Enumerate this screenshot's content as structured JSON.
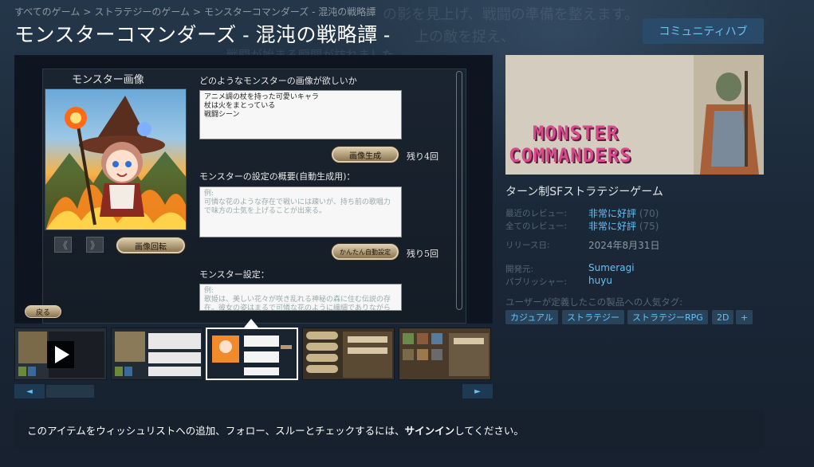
{
  "breadcrumb": [
    "すべてのゲーム",
    "ストラテジーのゲーム",
    "モンスターコマンダーズ - 混沌の戦略譚"
  ],
  "title": "モンスターコマンダーズ - 混沌の戦略譚 -",
  "community_hub": "コミュニティハブ",
  "background_text": [
    "の影を見上げ、戦闘の準備を整えます。",
    "上の敵を捉え、",
    "戦闘が始まる瞬間が訪れました"
  ],
  "game_ui": {
    "portrait_heading": "モンスター画像",
    "q1_label": "どのようなモンスターの画像が欲しいか",
    "q1_text": [
      "アニメ調の杖を持った可愛いキャラ",
      "杖は火をまとっている",
      "戦闘シーン"
    ],
    "generate_button": "画像生成",
    "generate_remaining": "残り4回",
    "q2_label": "モンスターの設定の概要(自動生成用)：",
    "q2_placeholder": [
      "例:",
      "可憐な花のような存在で戦いには疎いが、持ち前の歌唱力",
      "で味方の士気を上げることが出来る。"
    ],
    "auto_button": "かんたん自動設定",
    "auto_remaining": "残り5回",
    "rotate_button": "画像回転",
    "prev_arrow": "《",
    "next_arrow": "》",
    "q3_label": "モンスター設定：",
    "q3_placeholder": [
      "例:",
      "歌姫は、美しい花々が咲き乱れる神秘の森に住む伝説の存",
      "在。彼女の姿はまるで可憐な花のように繊細でありながら"
    ],
    "back_button": "戻る"
  },
  "slider": {
    "left": "◄",
    "right": "►"
  },
  "capsule_logo": [
    "MONSTER",
    "COMMANDERS"
  ],
  "short_desc": "ターン制SFストラテジーゲーム",
  "reviews": {
    "recent_label": "最近のレビュー:",
    "recent_value": "非常に好評",
    "recent_count": "(70)",
    "all_label": "全てのレビュー:",
    "all_value": "非常に好評",
    "all_count": "(75)"
  },
  "release": {
    "label": "リリース日:",
    "value": "2024年8月31日"
  },
  "developer": {
    "label": "開発元:",
    "value": "Sumeragi"
  },
  "publisher": {
    "label": "パブリッシャー:",
    "value": "huyu"
  },
  "tags_label": "ユーザーが定義したこの製品への人気タグ:",
  "tags": [
    "カジュアル",
    "ストラテジー",
    "ストラテジーRPG",
    "2D",
    "+"
  ],
  "signin": {
    "before": "このアイテムをウィッシュリストへの追加、フォロー、スルーとチェックするには、",
    "link": "サインイン",
    "after": "してください。"
  },
  "colors": {
    "accent": "#67c1f5",
    "bg": "#1b2838",
    "hub_button": "#2a4a6a"
  },
  "icons": [
    "play-icon",
    "left-arrow-icon",
    "right-arrow-icon"
  ]
}
